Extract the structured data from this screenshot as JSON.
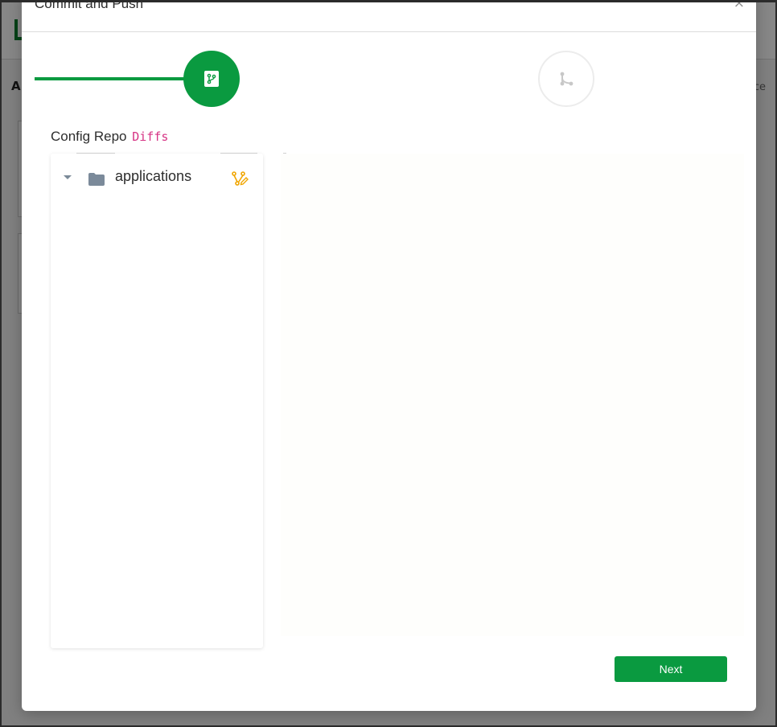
{
  "modal": {
    "title": "Commit and Push",
    "close_glyph": "×"
  },
  "background": {
    "letter": "A",
    "right_text": "ce"
  },
  "stepper": {
    "steps": [
      {
        "icon": "git-branch-icon",
        "state": "active"
      },
      {
        "icon": "git-merge-icon",
        "state": "inactive"
      }
    ]
  },
  "section": {
    "title": "Config Repo",
    "code": "Diffs"
  },
  "tree": {
    "items": [
      {
        "label": "applications",
        "icon": "folder-icon",
        "status_icon": "diff-edit-icon",
        "expanded": true
      }
    ]
  },
  "actions": {
    "next_label": "Next"
  },
  "colors": {
    "accent": "#0a9a40",
    "code_pink": "#d63384",
    "modified_orange": "#f0a500",
    "folder_gray": "#7b8a9a"
  }
}
